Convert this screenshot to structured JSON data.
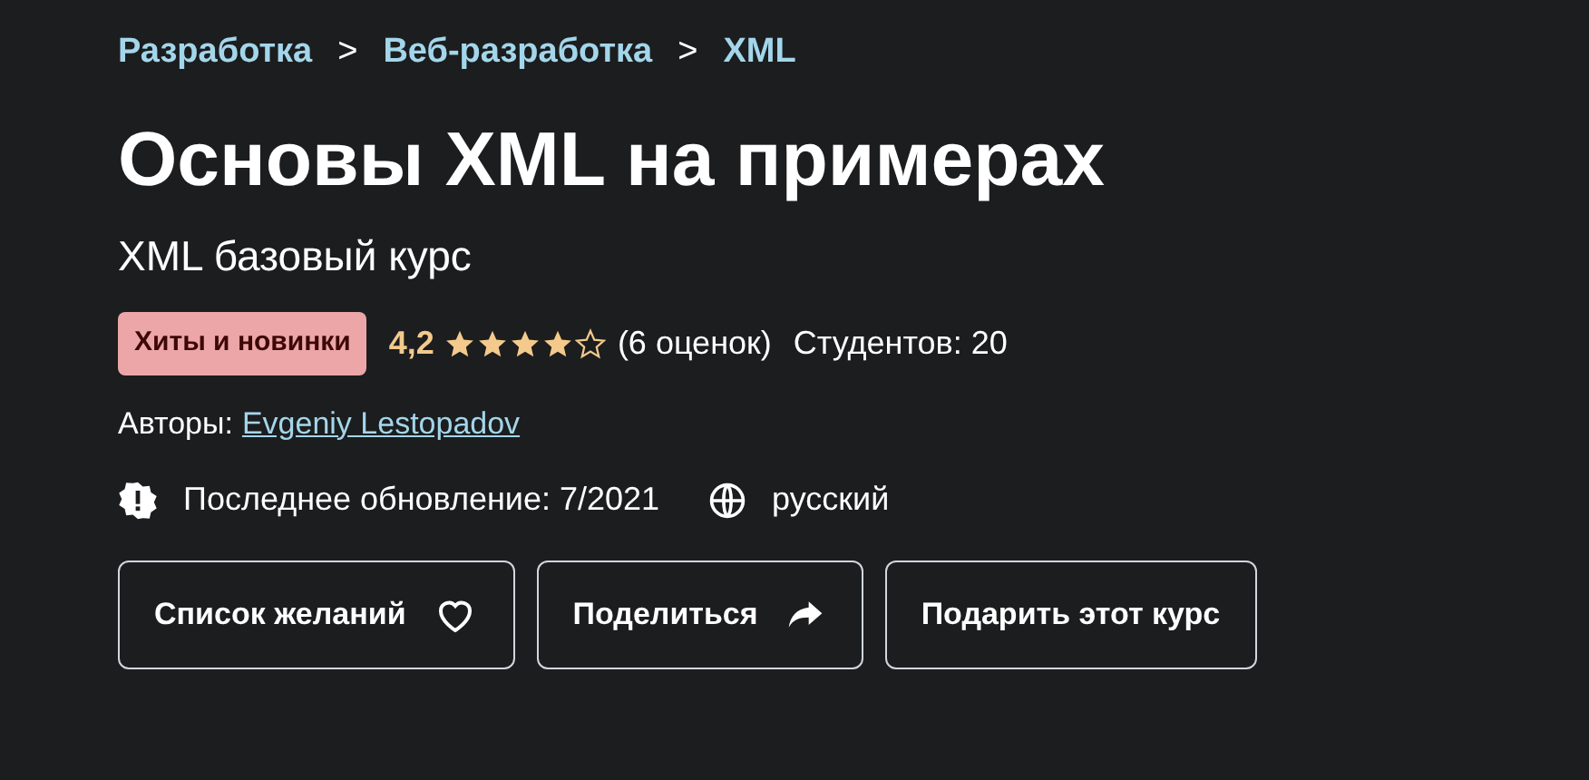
{
  "breadcrumbs": [
    {
      "label": "Разработка"
    },
    {
      "label": "Веб-разработка"
    },
    {
      "label": "XML"
    }
  ],
  "separator": ">",
  "title": "Основы XML на примерах",
  "subtitle": "XML базовый курс",
  "badge": "Хиты и новинки",
  "rating": {
    "value": "4,2",
    "stars": 4,
    "count": "(6 оценок)"
  },
  "students": "Студентов: 20",
  "authors": {
    "label": "Авторы:",
    "name": "Evgeniy Lestopadov"
  },
  "updated": "Последнее обновление: 7/2021",
  "language": "русский",
  "buttons": [
    {
      "label": "Список желаний",
      "kind": "heart"
    },
    {
      "label": "Поделиться",
      "kind": "share"
    },
    {
      "label": "Подарить этот курс",
      "kind": "plain"
    }
  ]
}
